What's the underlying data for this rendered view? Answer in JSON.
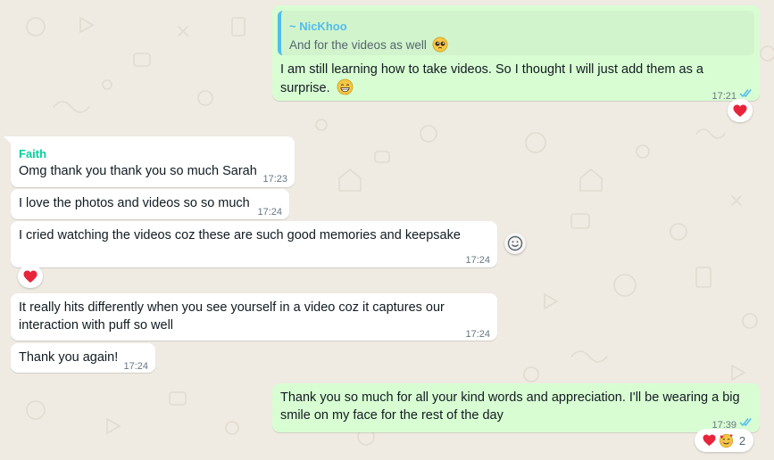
{
  "colors": {
    "wallpaper": "#efeae2",
    "incoming_bubble": "#ffffff",
    "outgoing_bubble": "#d9fdd3",
    "quote_bar": "#53bdeb",
    "sender_faith": "#06cf9c",
    "read_ticks": "#53bdeb"
  },
  "messages": [
    {
      "id": "m1",
      "direction": "outgoing",
      "quoted": {
        "author": "~ NicKhoo",
        "text": "And for the videos as well",
        "emoji": "pleading-face-icon"
      },
      "lines": [
        "I am still learning how to take videos. So I thought I will just add them as a",
        "surprise."
      ],
      "trailing_emoji": "grinning-face-icon",
      "time": "17:21",
      "status": "read",
      "reactions": [
        "heart"
      ]
    },
    {
      "id": "m2",
      "direction": "incoming",
      "sender": "Faith",
      "lines": [
        "Omg thank you thank you so much Sarah"
      ],
      "time": "17:23"
    },
    {
      "id": "m3",
      "direction": "incoming",
      "lines": [
        "I love the photos and videos so so much"
      ],
      "time": "17:24"
    },
    {
      "id": "m4",
      "direction": "incoming",
      "lines": [
        "I cried watching the videos coz these are such good memories and keepsake"
      ],
      "time": "17:24",
      "reactions": [
        "heart"
      ],
      "hover_action": "add-reaction-icon"
    },
    {
      "id": "m5",
      "direction": "incoming",
      "lines": [
        "It really hits differently when you see yourself in a video coz it captures our",
        "interaction with puff so well"
      ],
      "time": "17:24"
    },
    {
      "id": "m6",
      "direction": "incoming",
      "lines": [
        "Thank you again!"
      ],
      "time": "17:24"
    },
    {
      "id": "m7",
      "direction": "outgoing",
      "lines": [
        "Thank you so much for all your kind words and appreciation. I'll be wearing a big",
        "smile on my face for the rest of the day"
      ],
      "time": "17:39",
      "status": "read",
      "reactions": [
        "heart",
        "smiling-face-with-hearts"
      ],
      "reaction_count": "2"
    }
  ]
}
